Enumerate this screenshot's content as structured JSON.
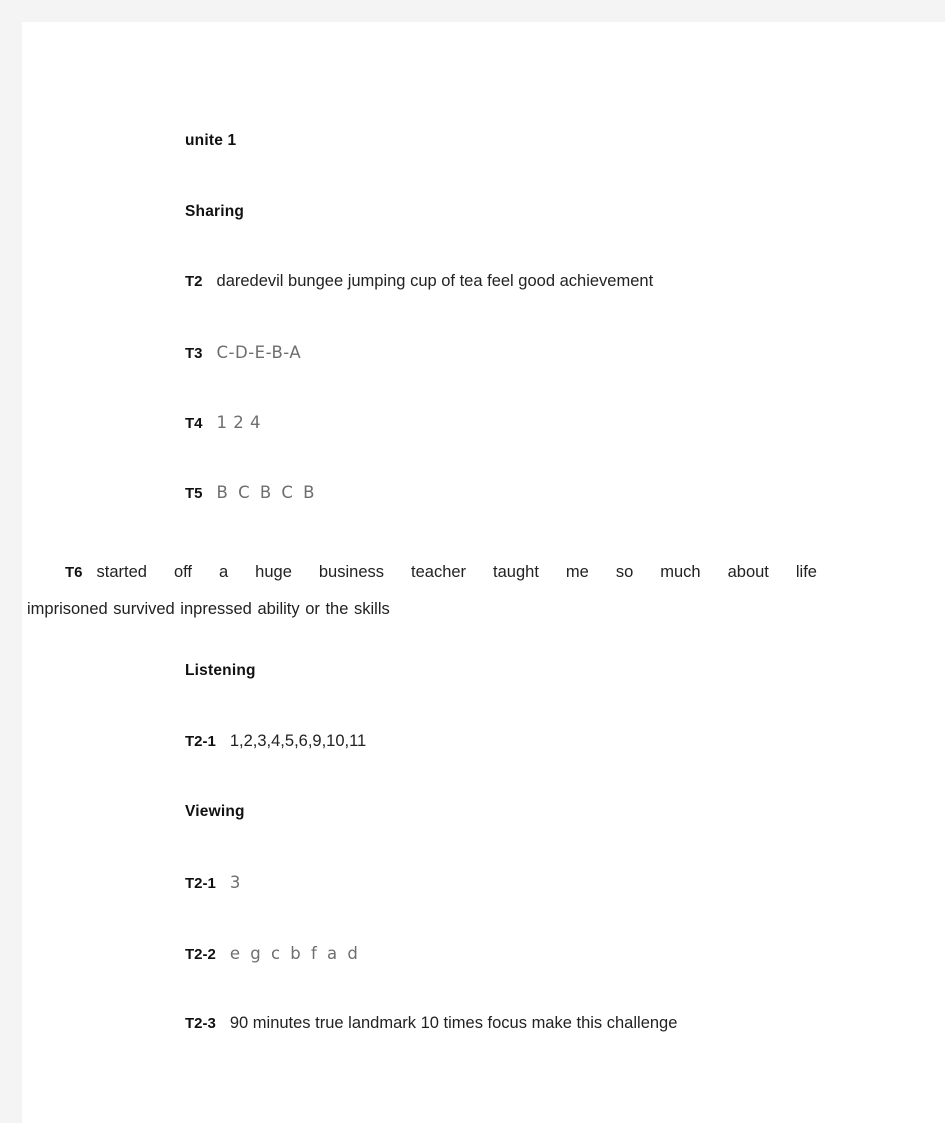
{
  "document": {
    "title": "unite 1",
    "background_color": "#f4f4f4",
    "page_color": "#ffffff"
  },
  "sections": [
    {
      "id": "sharing",
      "heading": "Sharing",
      "items": [
        {
          "tag": "T2",
          "answers": [
            "daredevil",
            "bungee jumping",
            "cup of tea",
            "feel good",
            "achievement"
          ],
          "text": "daredevil   bungee jumping    cup of tea   feel good    achievement"
        },
        {
          "tag": "T3",
          "answers": [
            "C",
            "D",
            "E",
            "B",
            "A"
          ],
          "text": "C-D-E-B-A"
        },
        {
          "tag": "T4",
          "answers": [
            "1",
            "2",
            "4"
          ],
          "text": "1 2 4"
        },
        {
          "tag": "T5",
          "answers": [
            "B",
            "C",
            "B",
            "C",
            "B"
          ],
          "text": "B C B C B"
        },
        {
          "tag": "T6",
          "answers": [
            "started off",
            "a huge business",
            "teacher",
            "taught me so much",
            "about life",
            "imprisoned",
            "survived",
            "inpressed",
            "ability or the skills"
          ],
          "line1": "started off    a huge business    teacher    taught me so much     about life",
          "line2": "imprisoned    survived    inpressed    ability or the skills"
        }
      ]
    },
    {
      "id": "listening",
      "heading": "Listening",
      "items": [
        {
          "tag": "T2-1",
          "answers": [
            "1",
            "2",
            "3",
            "4",
            "5",
            "6",
            "9",
            "10",
            "11"
          ],
          "text": "1,2,3,4,5,6,9,10,11"
        }
      ]
    },
    {
      "id": "viewing",
      "heading": "Viewing",
      "items": [
        {
          "tag": "T2-1",
          "answers": [
            "3"
          ],
          "text": "3"
        },
        {
          "tag": "T2-2",
          "answers": [
            "e",
            "g",
            "c",
            "b",
            "f",
            "a",
            "d"
          ],
          "text": "e g c b f a d"
        },
        {
          "tag": "T2-3",
          "answers": [
            "90 minutes",
            "true landmark",
            "10 times",
            "focus",
            "make this challenge"
          ],
          "text": "90 minutes     true landmark     10 times     focus     make this challenge"
        }
      ]
    }
  ]
}
